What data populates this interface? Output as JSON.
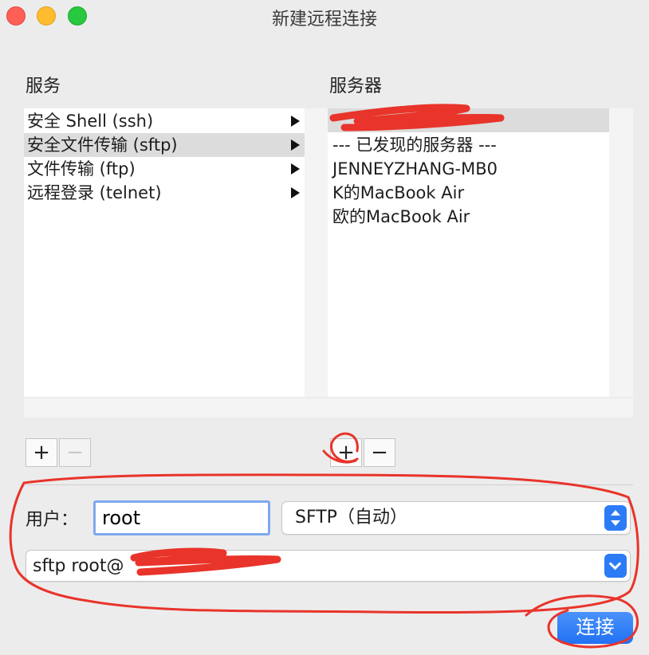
{
  "window": {
    "title": "新建远程连接"
  },
  "services": {
    "label": "服务",
    "items": [
      {
        "label": "安全 Shell (ssh)",
        "selected": false
      },
      {
        "label": "安全文件传输 (sftp)",
        "selected": true
      },
      {
        "label": "文件传输 (ftp)",
        "selected": false
      },
      {
        "label": "远程登录 (telnet)",
        "selected": false
      }
    ],
    "add_label": "+",
    "remove_label": "−"
  },
  "servers": {
    "label": "服务器",
    "items": [
      {
        "label": "",
        "selected": true
      },
      {
        "label": "--- 已发现的服务器 ---",
        "selected": false
      },
      {
        "label": "JENNEYZHANG-MB0",
        "selected": false
      },
      {
        "label": "K的MacBook Air",
        "selected": false
      },
      {
        "label": "欧的MacBook Air",
        "selected": false
      }
    ],
    "add_label": "+",
    "remove_label": "−"
  },
  "form": {
    "user_label": "用户：",
    "user_value": "root",
    "protocol_selected": "SFTP（自动）",
    "command_value": "sftp root@"
  },
  "connect_button": {
    "label": "连接",
    "accent": "#2c7bf6"
  },
  "colors": {
    "annotation_red": "#e8342a",
    "selection": "#dcdcdc"
  }
}
